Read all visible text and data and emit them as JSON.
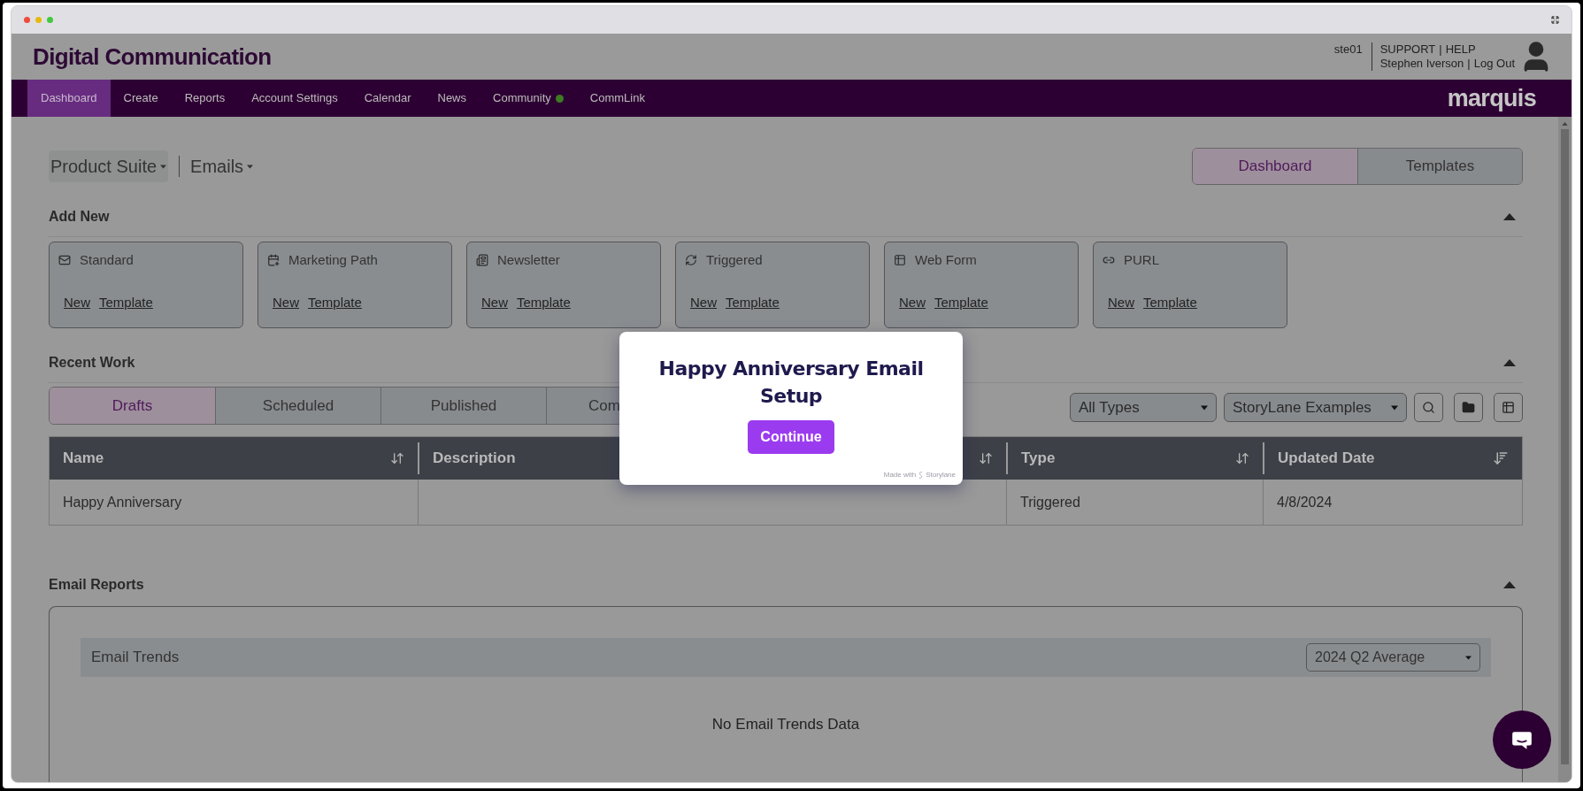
{
  "header": {
    "app_title": "Digital Communication",
    "account_code": "ste01",
    "link_rows": [
      {
        "links": [
          "SUPPORT",
          "HELP"
        ],
        "separator": "|"
      },
      {
        "links": [
          "Stephen Iverson",
          "Log Out"
        ],
        "separator": "|"
      }
    ]
  },
  "nav": {
    "items": [
      {
        "label": "Dashboard",
        "selected": true
      },
      {
        "label": "Create",
        "selected": false
      },
      {
        "label": "Reports",
        "selected": false
      },
      {
        "label": "Account Settings",
        "selected": false
      },
      {
        "label": "Calendar",
        "selected": false
      },
      {
        "label": "News",
        "selected": false
      },
      {
        "label": "Community",
        "selected": false,
        "indicator": true
      },
      {
        "label": "CommLink",
        "selected": false
      }
    ],
    "logo": "marquis"
  },
  "breadcrumb": {
    "product": "Product Suite",
    "section": "Emails"
  },
  "view_toggle": [
    {
      "label": "Dashboard",
      "selected": true
    },
    {
      "label": "Templates",
      "selected": false
    }
  ],
  "add_new": {
    "title": "Add New",
    "cards": [
      {
        "kind": "standard",
        "label": "Standard",
        "links": [
          "New",
          "Template"
        ]
      },
      {
        "kind": "path",
        "label": "Marketing Path",
        "links": [
          "New",
          "Template"
        ]
      },
      {
        "kind": "newsletter",
        "label": "Newsletter",
        "links": [
          "New",
          "Template"
        ]
      },
      {
        "kind": "triggered",
        "label": "Triggered",
        "links": [
          "New",
          "Template"
        ]
      },
      {
        "kind": "webform",
        "label": "Web Form",
        "links": [
          "New",
          "Template"
        ]
      },
      {
        "kind": "purl",
        "label": "PURL",
        "links": [
          "New",
          "Template"
        ]
      }
    ]
  },
  "recent_work": {
    "title": "Recent Work",
    "tabs": [
      {
        "label": "Drafts",
        "selected": true
      },
      {
        "label": "Scheduled",
        "selected": false
      },
      {
        "label": "Published",
        "selected": false
      },
      {
        "label": "Com",
        "selected": false
      }
    ],
    "filters": [
      "All Types",
      "StoryLane Examples"
    ],
    "table": {
      "columns": [
        {
          "label": "Name",
          "kind": "sortable"
        },
        {
          "label": "Description",
          "kind": "sortable"
        },
        {
          "label": "Type",
          "kind": "sortable"
        },
        {
          "label": "Updated Date",
          "kind": "sorted"
        }
      ],
      "rows": [
        {
          "name": "Happy Anniversary",
          "type": "Triggered",
          "updated_date": "4/8/2024"
        }
      ]
    }
  },
  "email_reports": {
    "title": "Email Reports",
    "trends_title": "Email Trends",
    "period": "2024 Q2 Average",
    "empty_message": "No Email Trends Data"
  },
  "modal": {
    "title": "Happy Anniversary Email Setup",
    "button": "Continue",
    "footer": "Made with",
    "brand": "Storylane"
  }
}
